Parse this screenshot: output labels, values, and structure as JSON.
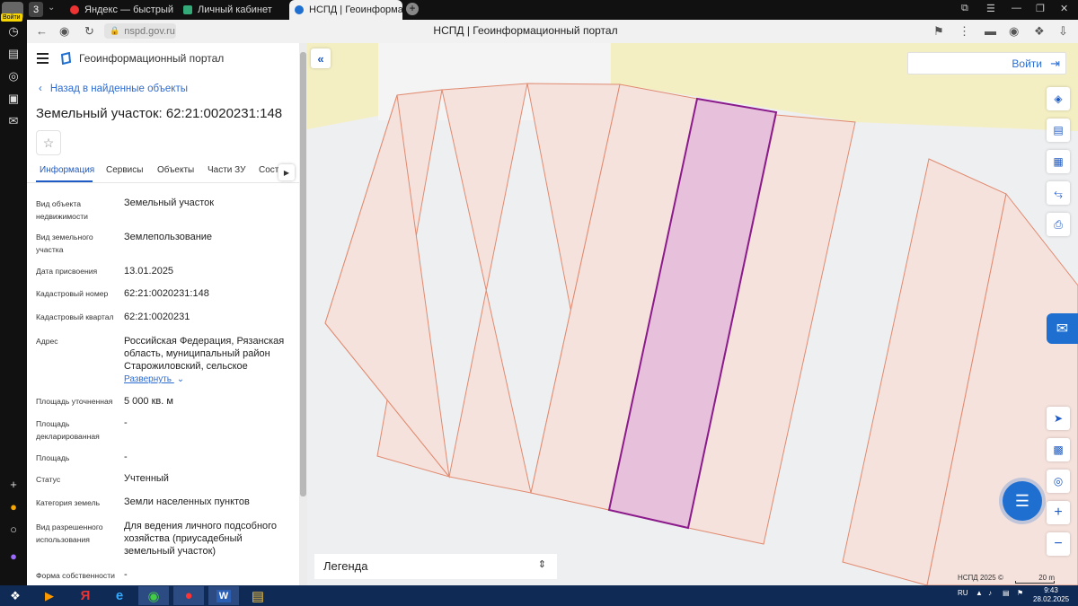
{
  "browser": {
    "profile_badge": "Войти",
    "tab_count": "3",
    "tabs": [
      {
        "label": "Яндекс — быстрый поиск",
        "fav_color": "#e33"
      },
      {
        "label": "Личный кабинет",
        "fav_color": "#3a7"
      },
      {
        "label": "НСПД | Геоинформаци",
        "fav_color": "#1f6fd1",
        "active": true
      }
    ],
    "url": "nspd.gov.ru",
    "page_title": "НСПД | Геоинформационный портал"
  },
  "panel": {
    "app_title": "Геоинформационный портал",
    "back_link": "Назад в найденные объекты",
    "heading": "Земельный участок: 62:21:0020231:148",
    "tabs": [
      "Информация",
      "Сервисы",
      "Объекты",
      "Части ЗУ",
      "Соста"
    ],
    "fields": [
      {
        "label": "Вид объекта недвижимости",
        "value": "Земельный участок"
      },
      {
        "label": "Вид земельного участка",
        "value": "Землепользование"
      },
      {
        "label": "Дата присвоения",
        "value": "13.01.2025"
      },
      {
        "label": "Кадастровый номер",
        "value": "62:21:0020231:148"
      },
      {
        "label": "Кадастровый квартал",
        "value": "62:21:0020231"
      },
      {
        "label": "Адрес",
        "value": "Российская Федерация, Рязанская область, муниципальный район Старожиловский, сельское"
      },
      {
        "label": "Площадь уточненная",
        "value": "5 000 кв. м"
      },
      {
        "label": "Площадь декларированная",
        "value": "-"
      },
      {
        "label": "Площадь",
        "value": "-"
      },
      {
        "label": "Статус",
        "value": "Учтенный"
      },
      {
        "label": "Категория земель",
        "value": "Земли населенных пунктов"
      },
      {
        "label": "Вид разрешенного использования",
        "value": "Для ведения личного подсобного хозяйства (приусадебный земельный участок)"
      },
      {
        "label": "Форма собственности",
        "value": "-"
      }
    ],
    "expand_link": "Развернуть"
  },
  "map": {
    "login_label": "Войти",
    "legend_label": "Легенда",
    "copyright": "НСПД 2025 ©",
    "scale_label": "20 m",
    "colors": {
      "parcel_fill": "#f6e2dc",
      "parcel_stroke": "#e08a70",
      "selected_fill": "#e7c1dc",
      "selected_stroke": "#8b1a8b",
      "field": "#f4efc3"
    },
    "tools": [
      "layers-icon",
      "ruler-icon",
      "select-area-icon",
      "share-icon",
      "print-icon",
      "helper-icon",
      "locate-icon",
      "minimap-icon",
      "search-location-icon",
      "zoom-in-icon",
      "zoom-out-icon"
    ]
  },
  "taskbar": {
    "lang": "RU",
    "time": "9:43",
    "date": "28.02.2025"
  }
}
